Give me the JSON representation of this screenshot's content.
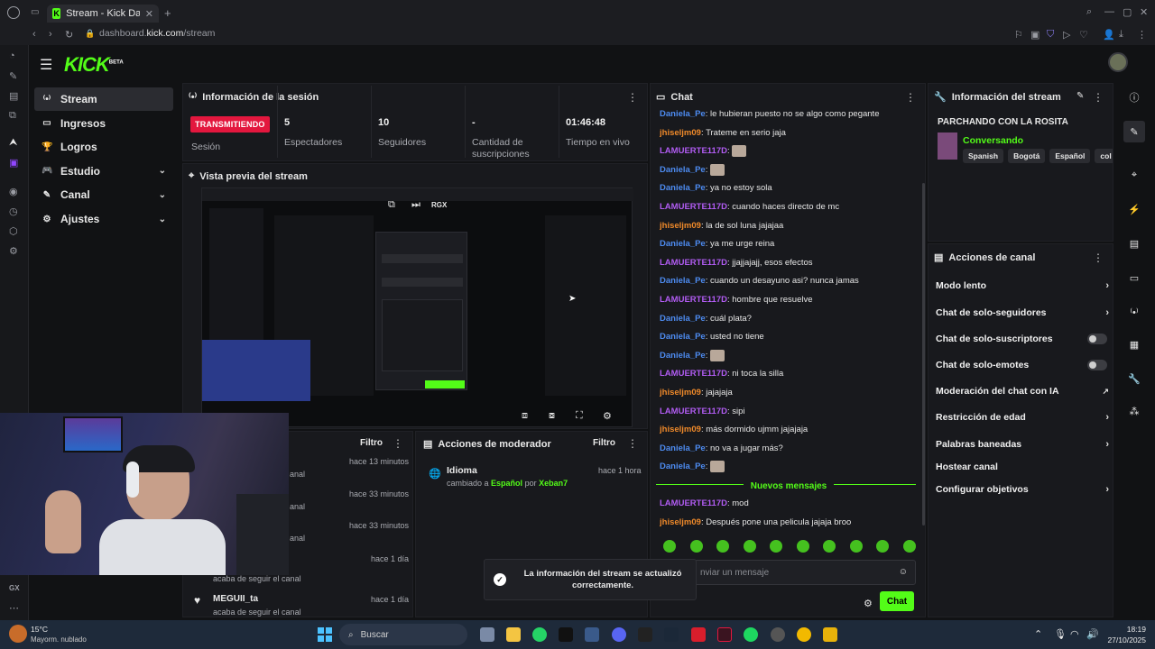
{
  "browser": {
    "tab_title": "Stream - Kick Dashbo",
    "url_domain": "dashboard.",
    "url_host": "kick.com",
    "url_path": "/stream"
  },
  "app": {
    "logo": "KICK",
    "logo_tag": "BETA"
  },
  "sidebar": {
    "items": [
      {
        "label": "Stream",
        "icon": "broadcast-icon",
        "active": true
      },
      {
        "label": "Ingresos",
        "icon": "money-icon"
      },
      {
        "label": "Logros",
        "icon": "trophy-icon"
      },
      {
        "label": "Estudio",
        "icon": "gamepad-icon",
        "expandable": true
      },
      {
        "label": "Canal",
        "icon": "pencil-icon",
        "expandable": true
      },
      {
        "label": "Ajustes",
        "icon": "gear-icon",
        "expandable": true
      }
    ]
  },
  "session": {
    "title": "Información de la sesión",
    "badge": "TRANSMITIENDO",
    "badge_label": "Sesión",
    "stats": [
      {
        "value": "5",
        "label": "Espectadores"
      },
      {
        "value": "10",
        "label": "Seguidores"
      },
      {
        "value": "-",
        "label": "Cantidad de suscripciones"
      },
      {
        "value": "01:46:48",
        "label": "Tiempo en vivo"
      }
    ]
  },
  "preview": {
    "title": "Vista previa del stream",
    "rgx": "RGX"
  },
  "followers": {
    "filter": "Filtro",
    "times": [
      "hace 13 minutos",
      "hace 33 minutos",
      "hace 33 minutos",
      "hace 1 día",
      "hace 1 día"
    ],
    "partial": [
      "anal",
      "anal",
      "anal"
    ],
    "follow_text": "acaba de seguir el canal",
    "last_user": "MEGUII_ta",
    "last_text": "acaba de seguir el canal"
  },
  "mod_actions": {
    "title": "Acciones de moderador",
    "filter": "Filtro",
    "item_title": "Idioma",
    "item_time": "hace 1 hora",
    "item_pre": "cambiado a",
    "item_lang": "Español",
    "item_mid": "por",
    "item_user": "Xeban7"
  },
  "chat": {
    "title": "Chat",
    "messages": [
      {
        "user": "Daniela_Pe",
        "text": "le hubieran puesto no se algo como pegante",
        "color": "#4d8bf0"
      },
      {
        "user": "jhiseljm09",
        "text": "Trateme en serio jaja",
        "color": "#f08a2a"
      },
      {
        "user": "LAMUERTE117D",
        "text": "",
        "color": "#b15cf2",
        "emote": true
      },
      {
        "user": "Daniela_Pe",
        "text": "",
        "color": "#4d8bf0",
        "emote": true
      },
      {
        "user": "Daniela_Pe",
        "text": "ya no estoy sola",
        "color": "#4d8bf0"
      },
      {
        "user": "LAMUERTE117D",
        "text": "cuando haces directo de mc",
        "color": "#b15cf2"
      },
      {
        "user": "jhiseljm09",
        "text": "la de sol luna jajajaa",
        "color": "#f08a2a"
      },
      {
        "user": "Daniela_Pe",
        "text": "ya me urge reina",
        "color": "#4d8bf0"
      },
      {
        "user": "LAMUERTE117D",
        "text": "jjajjajajj, esos efectos",
        "color": "#b15cf2"
      },
      {
        "user": "Daniela_Pe",
        "text": "cuando un desayuno asi? nunca jamas",
        "color": "#4d8bf0"
      },
      {
        "user": "LAMUERTE117D",
        "text": "hombre que resuelve",
        "color": "#b15cf2"
      },
      {
        "user": "Daniela_Pe",
        "text": "cuál plata?",
        "color": "#4d8bf0"
      },
      {
        "user": "Daniela_Pe",
        "text": "usted no tiene",
        "color": "#4d8bf0"
      },
      {
        "user": "Daniela_Pe",
        "text": "",
        "color": "#4d8bf0",
        "emote": true
      },
      {
        "user": "LAMUERTE117D",
        "text": "ni toca la silla",
        "color": "#b15cf2"
      },
      {
        "user": "jhiseljm09",
        "text": "jajajaja",
        "color": "#f08a2a"
      },
      {
        "user": "LAMUERTE117D",
        "text": "sipi",
        "color": "#b15cf2"
      },
      {
        "user": "jhiseljm09",
        "text": "más dormido ujmm jajajaja",
        "color": "#f08a2a"
      },
      {
        "user": "Daniela_Pe",
        "text": "no va a jugar más?",
        "color": "#4d8bf0"
      },
      {
        "user": "Daniela_Pe",
        "text": "",
        "color": "#4d8bf0",
        "emote": true
      }
    ],
    "new_messages": "Nuevos mensajes",
    "new": [
      {
        "user": "LAMUERTE117D",
        "text": "mod",
        "color": "#b15cf2"
      },
      {
        "user": "jhiseljm09",
        "text": "Después pone una pelicula jajaja broo",
        "color": "#f08a2a"
      }
    ],
    "input_placeholder": "nviar un mensaje",
    "send": "Chat"
  },
  "stream_info": {
    "title": "Información del stream",
    "stream_title": "PARCHANDO CON LA ROSITA",
    "category": "Conversando",
    "tags": [
      "Spanish",
      "Bogotá",
      "Español",
      "col"
    ]
  },
  "channel_actions": {
    "title": "Acciones de canal",
    "items": [
      {
        "label": "Modo lento",
        "kind": "arrow"
      },
      {
        "label": "Chat de solo-seguidores",
        "kind": "arrow"
      },
      {
        "label": "Chat de solo-suscriptores",
        "kind": "toggle"
      },
      {
        "label": "Chat de solo-emotes",
        "kind": "toggle"
      },
      {
        "label": "Moderación del chat con IA",
        "kind": "external"
      },
      {
        "label": "Restricción de edad",
        "kind": "arrow"
      },
      {
        "label": "Palabras baneadas",
        "kind": "arrow"
      },
      {
        "label": "Hostear canal",
        "kind": "none"
      },
      {
        "label": "Configurar objetivos",
        "kind": "arrow"
      }
    ]
  },
  "toast": {
    "line1": "La información del stream se actualizó",
    "line2": "correctamente."
  },
  "taskbar": {
    "weather_temp": "15°C",
    "weather_desc": "Mayorm. nublado",
    "search": "Buscar",
    "time": "18:19",
    "date": "27/10/2025"
  },
  "opera": {
    "gx_label": "GX"
  },
  "colors": {
    "accent": "#53fc18",
    "live": "#e3173e",
    "bg": "#111214",
    "panel": "#18191d"
  }
}
